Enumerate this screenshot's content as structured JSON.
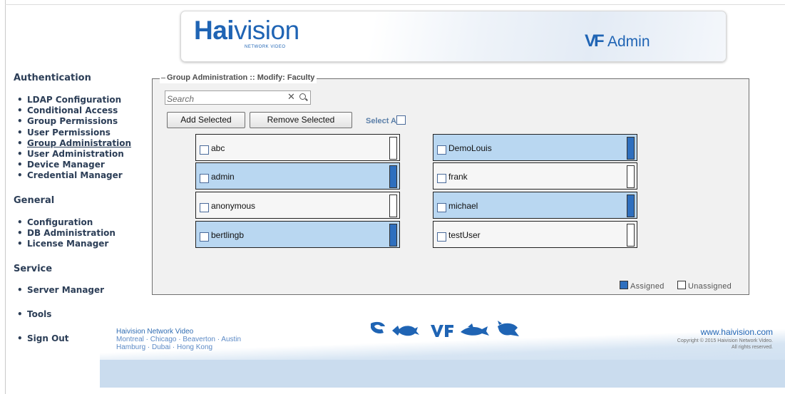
{
  "header": {
    "logo_main": "Hai",
    "logo_rest": "vision",
    "logo_sub": "NETWORK VIDEO",
    "product_mark": "VF",
    "product_name": "Admin"
  },
  "nav": {
    "sections": [
      {
        "heading": "Authentication",
        "items": [
          {
            "label": "LDAP Configuration"
          },
          {
            "label": "Conditional Access"
          },
          {
            "label": "Group Permissions"
          },
          {
            "label": "User Permissions"
          },
          {
            "label": "Group Administration",
            "active": true
          },
          {
            "label": "User Administration"
          },
          {
            "label": "Device Manager"
          },
          {
            "label": "Credential Manager"
          }
        ]
      },
      {
        "heading": "General",
        "items": [
          {
            "label": "Configuration"
          },
          {
            "label": "DB Administration"
          },
          {
            "label": "License Manager"
          }
        ]
      },
      {
        "heading": "Service",
        "items": [
          {
            "label": "Server Manager"
          }
        ]
      }
    ],
    "tools_label": "Tools",
    "signout_label": "Sign Out",
    "bullet": "•"
  },
  "group_admin": {
    "legend": "Group Administration :: Modify: Faculty",
    "search_placeholder": "Search",
    "clear_glyph": "✕",
    "add_selected": "Add Selected",
    "remove_selected": "Remove Selected",
    "select_all": "Select All",
    "users_left": [
      {
        "name": "abc",
        "assigned": false
      },
      {
        "name": "admin",
        "assigned": true
      },
      {
        "name": "anonymous",
        "assigned": false
      },
      {
        "name": "bertlingb",
        "assigned": true
      }
    ],
    "users_right": [
      {
        "name": "DemoLouis",
        "assigned": true
      },
      {
        "name": "frank",
        "assigned": false
      },
      {
        "name": "michael",
        "assigned": true
      },
      {
        "name": "testUser",
        "assigned": false
      }
    ],
    "legend_assigned": "Assigned",
    "legend_unassigned": "Unassigned",
    "colors": {
      "assigned_tile": "#b9d7f1",
      "assigned_bar": "#2e6fbe",
      "unassigned_tile": "#f6f6f6"
    }
  },
  "footer": {
    "company_name": "Haivision Network Video",
    "cities_line1": "Montreal · Chicago · Beaverton · Austin",
    "cities_line2": "Hamburg · Dubai · Hong Kong",
    "website": "www.haivision.com",
    "copyright": "Copyright © 2015 Haivision Network Video.",
    "rights": "All rights reserved.",
    "mascot_icons": [
      "shark-icon",
      "fish-icon",
      "vf-icon",
      "shark-icon",
      "anglerfish-icon"
    ]
  },
  "brand_color": "#1f64b4"
}
